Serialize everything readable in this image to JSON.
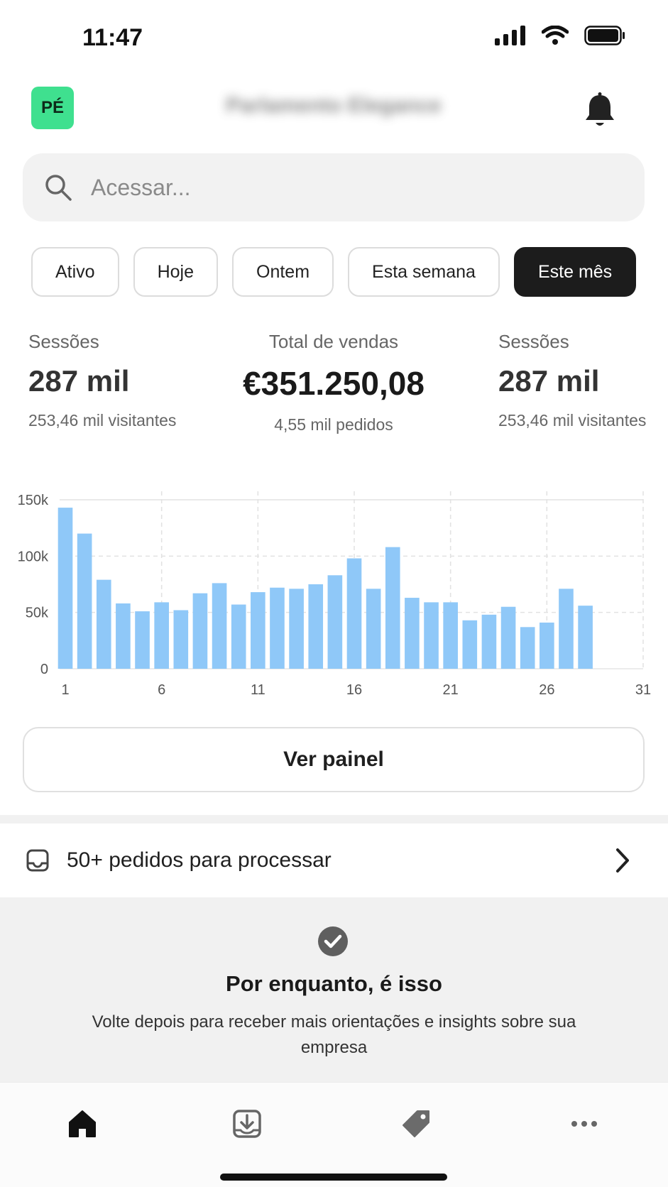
{
  "status_bar": {
    "time": "11:47"
  },
  "header": {
    "avatar_initials": "PÉ",
    "store_name": "Parlamento Elegance"
  },
  "search": {
    "placeholder": "Acessar..."
  },
  "filters": {
    "items": [
      "Ativo",
      "Hoje",
      "Ontem",
      "Esta semana",
      "Este mês"
    ],
    "active": "Este mês"
  },
  "metrics": {
    "left": {
      "label": "Sessões",
      "value": "287 mil",
      "sub": "253,46 mil visitantes"
    },
    "center": {
      "label": "Total de vendas",
      "value": "€351.250,08",
      "sub": "4,55 mil pedidos"
    },
    "right": {
      "label": "Sessões",
      "value": "287 mil",
      "sub": "253,46 mil visitantes"
    }
  },
  "chart_data": {
    "type": "bar",
    "x": [
      1,
      2,
      3,
      4,
      5,
      6,
      7,
      8,
      9,
      10,
      11,
      12,
      13,
      14,
      15,
      16,
      17,
      18,
      19,
      20,
      21,
      22,
      23,
      24,
      25,
      26,
      27,
      28
    ],
    "values": [
      143000,
      120000,
      79000,
      58000,
      51000,
      59000,
      52000,
      67000,
      76000,
      57000,
      68000,
      72000,
      71000,
      75000,
      83000,
      98000,
      71000,
      108000,
      63000,
      59000,
      59000,
      43000,
      48000,
      55000,
      37000,
      41000,
      71000,
      56000
    ],
    "xticks": [
      "1",
      "6",
      "11",
      "16",
      "21",
      "26",
      "31"
    ],
    "xtick_values": [
      1,
      6,
      11,
      16,
      21,
      26,
      31
    ],
    "yticks": [
      "0",
      "50k",
      "100k",
      "150k"
    ],
    "ytick_values": [
      0,
      50000,
      100000,
      150000
    ],
    "xlim": [
      1,
      31
    ],
    "ylim": [
      0,
      150000
    ],
    "bar_color": "#8fc8f8",
    "grid": true
  },
  "actions": {
    "view_dashboard": "Ver painel"
  },
  "orders": {
    "label": "50+ pedidos para processar"
  },
  "empty_state": {
    "title": "Por enquanto, é isso",
    "description": "Volte depois para receber mais orientações e insights sobre sua empresa"
  },
  "tabbar": {
    "icons": [
      "home-icon",
      "download-inbox-icon",
      "tag-icon",
      "more-icon"
    ]
  },
  "colors": {
    "accent": "#3fe08f",
    "active_chip": "#1c1c1c",
    "bar": "#8fc8f8"
  }
}
